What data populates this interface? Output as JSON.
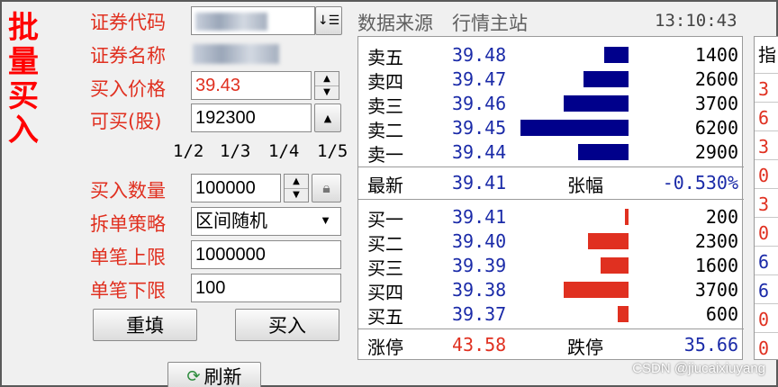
{
  "side_title": [
    "批",
    "量",
    "买",
    "入"
  ],
  "form": {
    "code_label": "证券代码",
    "name_label": "证券名称",
    "price_label": "买入价格",
    "price_value": "39.43",
    "can_buy_label": "可买(股)",
    "can_buy_value": "192300",
    "fractions": [
      "1/2",
      "1/3",
      "1/4",
      "1/5"
    ],
    "qty_label": "买入数量",
    "qty_value": "100000",
    "strategy_label": "拆单策略",
    "strategy_value": "区间随机",
    "upper_label": "单笔上限",
    "upper_value": "1000000",
    "lower_label": "单笔下限",
    "lower_value": "100",
    "reset_label": "重填",
    "buy_label": "买入",
    "refresh_label": "刷新"
  },
  "header": {
    "source_label": "数据来源",
    "source_value": "行情主站",
    "time": "13:10:43"
  },
  "sells": [
    {
      "name": "卖五",
      "price": "39.48",
      "vol": "1400",
      "level": 0.2258
    },
    {
      "name": "卖四",
      "price": "39.47",
      "vol": "2600",
      "level": 0.4194
    },
    {
      "name": "卖三",
      "price": "39.46",
      "vol": "3700",
      "level": 0.5968
    },
    {
      "name": "卖二",
      "price": "39.45",
      "vol": "6200",
      "level": 1.0
    },
    {
      "name": "卖一",
      "price": "39.44",
      "vol": "2900",
      "level": 0.4677
    }
  ],
  "latest": {
    "label": "最新",
    "price": "39.41",
    "change_label": "张幅",
    "change": "-0.530%"
  },
  "buys": [
    {
      "name": "买一",
      "price": "39.41",
      "vol": "200",
      "level": 0.0323
    },
    {
      "name": "买二",
      "price": "39.40",
      "vol": "2300",
      "level": 0.371
    },
    {
      "name": "买三",
      "price": "39.39",
      "vol": "1600",
      "level": 0.2581
    },
    {
      "name": "买四",
      "price": "39.38",
      "vol": "3700",
      "level": 0.5968
    },
    {
      "name": "买五",
      "price": "39.37",
      "vol": "600",
      "level": 0.0968
    }
  ],
  "limits": {
    "up_label": "涨停",
    "up": "43.58",
    "down_label": "跌停",
    "down": "35.66"
  },
  "right_column": {
    "header": "指",
    "values": [
      "3",
      "6",
      "3",
      "0",
      "3",
      "0",
      "6",
      "6",
      "0",
      "0",
      "0"
    ]
  },
  "watermark": "CSDN @jiucaixiuyang",
  "colors": {
    "accent_red": "#e03020",
    "sell_bar": "#00008b",
    "buy_bar": "#e03020",
    "price_blue": "#1a2aa8"
  }
}
